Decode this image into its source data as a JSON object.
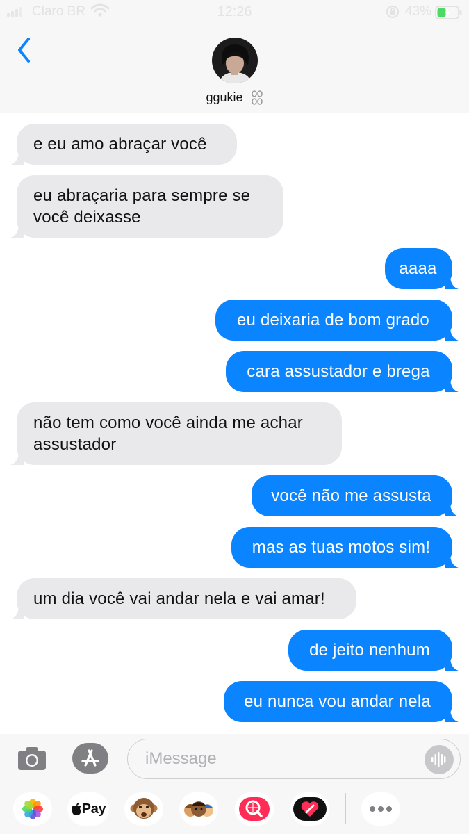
{
  "status_bar": {
    "carrier": "Claro BR",
    "time": "12:26",
    "battery_percent": "43%",
    "battery_level": 0.43
  },
  "header": {
    "contact_name": "ggukie"
  },
  "messages": [
    {
      "direction": "incoming",
      "lines": [
        "e eu amo abraçar você"
      ]
    },
    {
      "direction": "incoming",
      "lines": [
        "eu abraçaria para sempre se",
        "você deixasse"
      ]
    },
    {
      "direction": "outgoing",
      "lines": [
        "aaaa"
      ]
    },
    {
      "direction": "outgoing",
      "lines": [
        "eu deixaria de bom grado"
      ]
    },
    {
      "direction": "outgoing",
      "lines": [
        "cara assustador e brega"
      ]
    },
    {
      "direction": "incoming",
      "lines": [
        "não tem como você ainda me achar",
        "assustador"
      ]
    },
    {
      "direction": "outgoing",
      "lines": [
        "você não me assusta"
      ]
    },
    {
      "direction": "outgoing",
      "lines": [
        "mas as tuas motos sim!"
      ]
    },
    {
      "direction": "incoming",
      "lines": [
        "um dia você vai andar nela e vai amar!"
      ]
    },
    {
      "direction": "outgoing",
      "lines": [
        "de jeito nenhum"
      ]
    },
    {
      "direction": "outgoing",
      "lines": [
        "eu nunca vou andar nela"
      ]
    }
  ],
  "composer": {
    "placeholder": "iMessage"
  },
  "app_tray": {
    "apple_pay_label": "Pay",
    "icons": [
      "photos-icon",
      "apple-pay-icon",
      "monkey-animoji-icon",
      "memoji-icon",
      "web-search-icon",
      "digital-touch-icon",
      "more-apps-icon"
    ]
  },
  "colors": {
    "outgoing_bubble": "#0a84ff",
    "incoming_bubble": "#e9e9eb",
    "back_chevron": "#0a84ff"
  }
}
